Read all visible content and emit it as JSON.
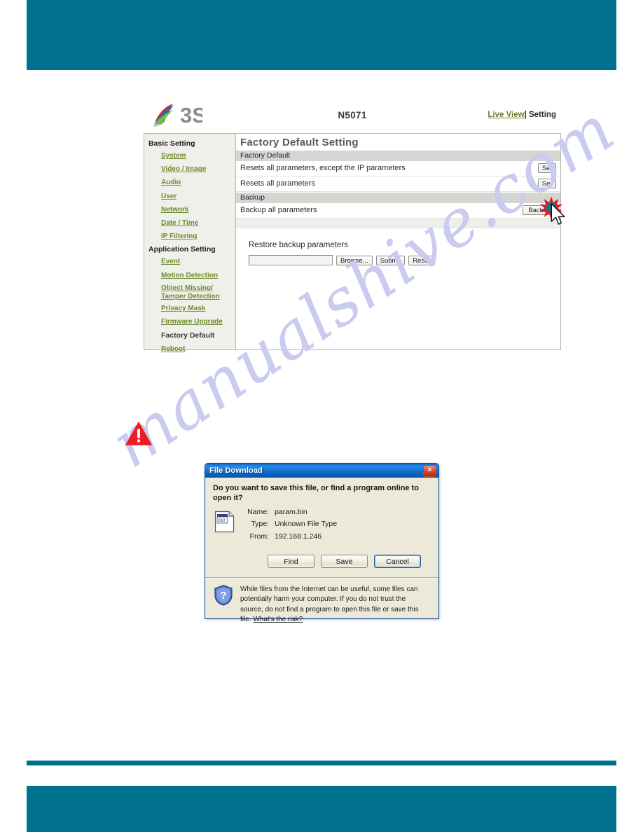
{
  "page": {
    "accent_color": "#00718f",
    "watermark_text": "manualshive.com",
    "watermark_color": "#c9cbef"
  },
  "camera_ui": {
    "logo_alt": "3S",
    "logo_text": "3S",
    "model": "N5071",
    "nav": {
      "live_view": "Live View",
      "separator": "|",
      "setting": "Setting"
    },
    "sidebar": {
      "groups": [
        {
          "title": "Basic Setting",
          "items": [
            {
              "label": "System",
              "current": false
            },
            {
              "label": "Video / Image",
              "current": false
            },
            {
              "label": "Audio",
              "current": false
            },
            {
              "label": "User",
              "current": false
            },
            {
              "label": "Network",
              "current": false
            },
            {
              "label": "Date / Time",
              "current": false
            },
            {
              "label": "IP Filtering",
              "current": false
            }
          ]
        },
        {
          "title": "Application Setting",
          "items": [
            {
              "label": "Event",
              "current": false
            },
            {
              "label": "Motion Detection",
              "current": false
            },
            {
              "label": "Object Missing/ Tamper Detection",
              "current": false
            },
            {
              "label": "Privacy Mask",
              "current": false
            },
            {
              "label": "Firmware Upgrade",
              "current": false
            },
            {
              "label": "Factory Default",
              "current": true
            },
            {
              "label": "Reboot",
              "current": false
            }
          ]
        }
      ]
    },
    "content": {
      "title": "Factory Default Setting",
      "section_factory_default": "Factory Default",
      "row_reset_except_ip": "Resets all parameters, except the IP parameters",
      "row_reset_all": "Resets all parameters",
      "set_button_1": "Set",
      "set_button_2": "Set",
      "section_backup": "Backup",
      "row_backup_all": "Backup all parameters",
      "backup_button": "Backup",
      "restore_label": "Restore backup parameters",
      "restore_file_value": "",
      "browse_button": "Browse...",
      "submit_button": "Submit",
      "reset_button": "Reset"
    }
  },
  "dialog": {
    "title": "File Download",
    "close_label": "×",
    "question": "Do you want to save this file, or find a program online to open it?",
    "fields": [
      {
        "key": "Name:",
        "value": "param.bin"
      },
      {
        "key": "Type:",
        "value": "Unknown File Type"
      },
      {
        "key": "From:",
        "value": "192.168.1.246"
      }
    ],
    "buttons": {
      "find": "Find",
      "save": "Save",
      "cancel": "Cancel"
    },
    "note": "While files from the Internet can be useful, some files can potentially harm your computer. If you do not trust the source, do not find a program to open this file or save this file.",
    "note_link": "What's the risk?"
  }
}
